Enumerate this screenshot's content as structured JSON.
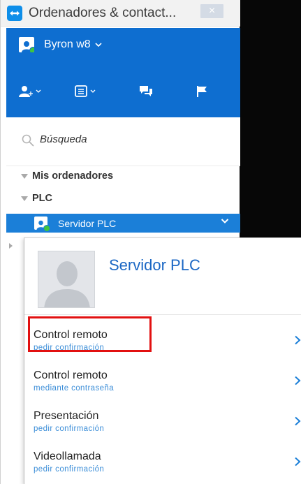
{
  "window": {
    "title": "Ordenadores & contact...",
    "close_symbol": "×"
  },
  "account": {
    "user_name": "Byron w8",
    "chevron": "⌄"
  },
  "toolbar": {
    "icons": [
      "add-contact-icon",
      "list-icon",
      "chat-icon",
      "flag-icon"
    ]
  },
  "search": {
    "placeholder": "Búsqueda"
  },
  "groups": {
    "mis_ordenadores": "Mis ordenadores",
    "plc": "PLC"
  },
  "selected_contact": {
    "name": "Servidor PLC"
  },
  "popup": {
    "title": "Servidor PLC",
    "actions": [
      {
        "label": "Control remoto",
        "sub": "pedir confirmación"
      },
      {
        "label": "Control remoto",
        "sub": "mediante contraseña"
      },
      {
        "label": "Presentación",
        "sub": "pedir confirmación"
      },
      {
        "label": "Videollamada",
        "sub": "pedir confirmación"
      }
    ]
  },
  "colors": {
    "header_blue": "#0e6ed0",
    "selected_blue": "#1b7fd8",
    "link_blue": "#3c8ed8",
    "highlight_red": "#e21010",
    "status_green": "#3fc43f"
  }
}
